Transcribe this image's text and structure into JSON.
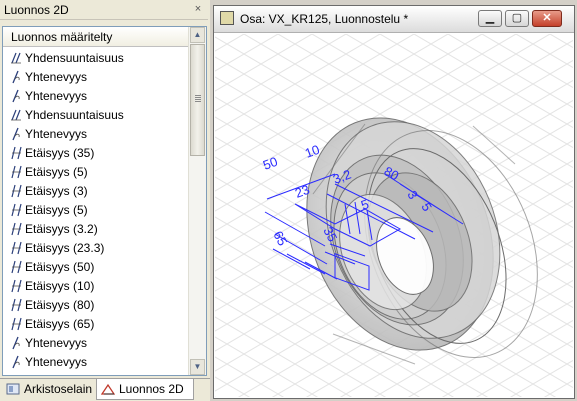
{
  "panel": {
    "title": "Luonnos 2D",
    "close_glyph": "×",
    "list_header": "Luonnos määritelty",
    "items": [
      {
        "icon": "parallel-constraint-icon",
        "label": "Yhdensuuntaisuus"
      },
      {
        "icon": "coincident-constraint-icon",
        "label": "Yhtenevyys"
      },
      {
        "icon": "coincident-constraint-icon",
        "label": "Yhtenevyys"
      },
      {
        "icon": "parallel-constraint-icon",
        "label": "Yhdensuuntaisuus"
      },
      {
        "icon": "coincident-constraint-icon",
        "label": "Yhtenevyys"
      },
      {
        "icon": "distance-constraint-icon",
        "label": "Etäisyys (35)"
      },
      {
        "icon": "distance-constraint-icon",
        "label": "Etäisyys (5)"
      },
      {
        "icon": "distance-constraint-icon",
        "label": "Etäisyys (3)"
      },
      {
        "icon": "distance-constraint-icon",
        "label": "Etäisyys (5)"
      },
      {
        "icon": "distance-constraint-icon",
        "label": "Etäisyys (3.2)"
      },
      {
        "icon": "distance-constraint-icon",
        "label": "Etäisyys (23.3)"
      },
      {
        "icon": "distance-constraint-icon",
        "label": "Etäisyys (50)"
      },
      {
        "icon": "distance-constraint-icon",
        "label": "Etäisyys (10)"
      },
      {
        "icon": "distance-constraint-icon",
        "label": "Etäisyys (80)"
      },
      {
        "icon": "distance-constraint-icon",
        "label": "Etäisyys (65)"
      },
      {
        "icon": "coincident-constraint-icon",
        "label": "Yhtenevyys"
      },
      {
        "icon": "coincident-constraint-icon",
        "label": "Yhtenevyys"
      }
    ],
    "tabs": [
      {
        "icon": "archive-browser-icon",
        "label": "Arkistoselain"
      },
      {
        "icon": "sketch-2d-icon",
        "label": "Luonnos 2D"
      }
    ]
  },
  "window": {
    "title": "Osa: VX_KR125, Luonnostelu *",
    "min_glyph": "▁",
    "max_glyph": "▢",
    "close_glyph": "✕"
  },
  "dimensions": {
    "d50": "50",
    "d10": "10",
    "d80": "80",
    "d3": "3",
    "d5": "5",
    "d23": "23",
    "d65": "65",
    "d35": "35",
    "d32": "3,2",
    "d5b": "5"
  },
  "colors": {
    "dimension": "#2a2aff",
    "part_fill": "#c8c8c8",
    "part_edge": "#6a6a6a",
    "grid": "#e2e2e2"
  }
}
